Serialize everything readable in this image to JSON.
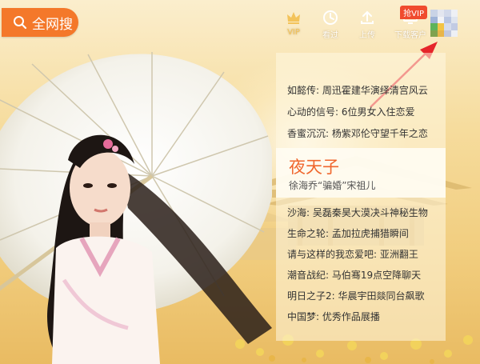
{
  "search": {
    "label": "全网搜"
  },
  "toolbar": {
    "vip_label": "VIP",
    "history_label": "看过",
    "upload_label": "上传",
    "download_label": "下载客户",
    "vip_badge": "抢VIP"
  },
  "news_top": [
    "如懿传: 周迅霍建华演绎清宫风云",
    "心动的信号: 6位男女入住恋爱",
    "香蜜沉沉: 杨紫邓伦守望千年之恋"
  ],
  "featured": {
    "title": "夜天子",
    "subtitle": "徐海乔“骗婚”宋祖儿"
  },
  "news_bottom": [
    "沙海: 吴磊秦昊大漠决斗神秘生物",
    "生命之轮: 孟加拉虎捕猎瞬间",
    "请与这样的我恋爱吧: 亚洲翻王",
    "潮音战纪: 马伯骞19点空降聊天",
    "明日之子2: 华晨宇田燚同台飙歌",
    "中国梦: 优秀作品展播"
  ],
  "colors": {
    "accent": "#f4782a",
    "featured_title": "#f0672e",
    "badge": "#f04b2e",
    "annotation_arrow": "#e5252a"
  }
}
